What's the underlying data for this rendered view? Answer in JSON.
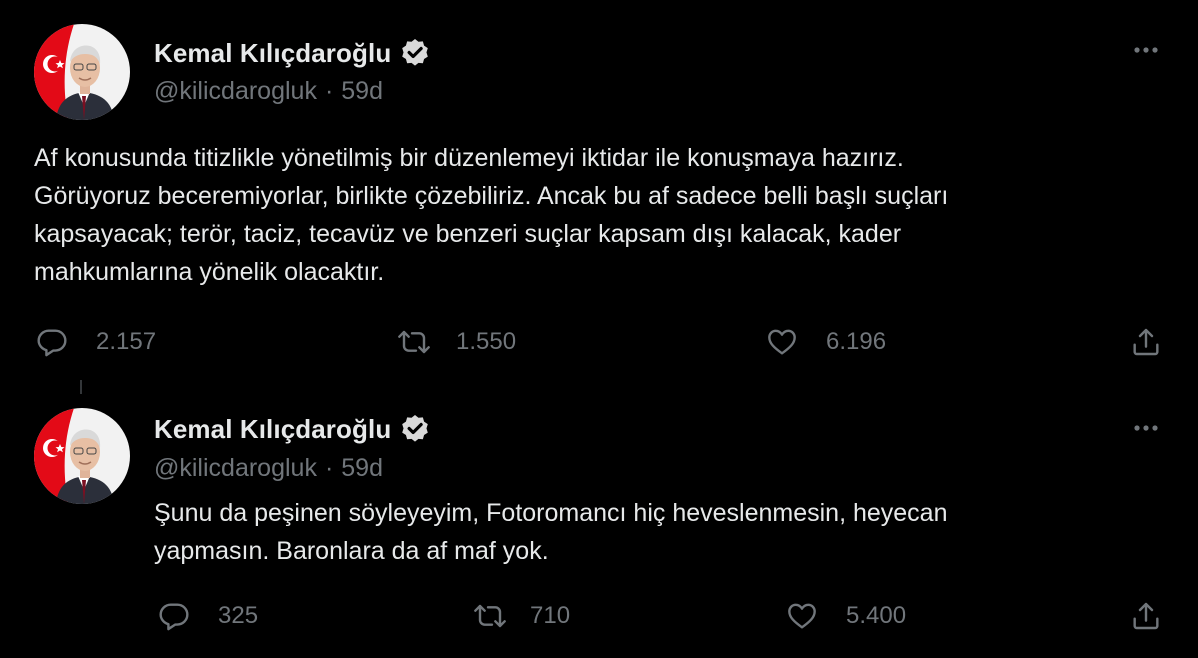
{
  "tweets": [
    {
      "display_name": "Kemal Kılıçdaroğlu",
      "handle": "@kilicdarogluk",
      "separator": "·",
      "time": "59d",
      "text": "Af konusunda titizlikle yönetilmiş bir düzenlemeyi iktidar ile konuşmaya hazırız.\nGörüyoruz beceremiyorlar, birlikte çözebiliriz. Ancak bu af sadece belli başlı suçları\nkapsayacak; terör, taciz, tecavüz ve benzeri suçlar kapsam dışı kalacak, kader\nmahkumlarına yönelik olacaktır.",
      "replies": "2.157",
      "retweets": "1.550",
      "likes": "6.196"
    },
    {
      "display_name": "Kemal Kılıçdaroğlu",
      "handle": "@kilicdarogluk",
      "separator": "·",
      "time": "59d",
      "text": "Şunu da peşinen söyleyeyim, Fotoromancı hiç heveslenmesin, heyecan\nyapmasın. Baronlara da af maf yok.",
      "replies": "325",
      "retweets": "710",
      "likes": "5.400"
    }
  ],
  "icons": {
    "verified": "verified-badge-icon",
    "more": "more-options-icon",
    "reply": "reply-icon",
    "retweet": "retweet-icon",
    "like": "heart-icon",
    "share": "share-icon"
  },
  "colors": {
    "background": "#000000",
    "text": "#e7e9ea",
    "secondary_text": "#71767b",
    "verified_badge": "#d9d9d9",
    "avatar_flag_red": "#e30a17"
  }
}
